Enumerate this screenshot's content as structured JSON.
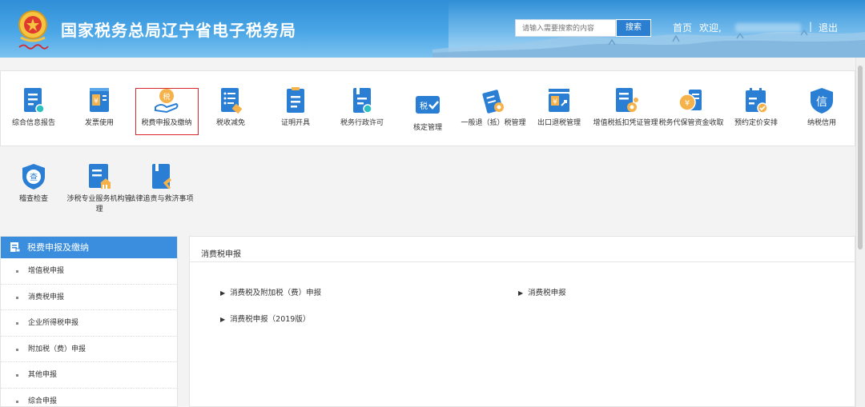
{
  "header": {
    "site_title": "国家税务总局辽宁省电子税务局",
    "search_placeholder": "请输入需要搜索的内容",
    "search_button": "搜索",
    "nav_home": "首页",
    "nav_welcome": "欢迎,",
    "nav_separator": "|",
    "nav_logout": "退出"
  },
  "menu": {
    "items": [
      {
        "label": "综合信息报告",
        "icon": "info-report-icon"
      },
      {
        "label": "发票使用",
        "icon": "invoice-icon"
      },
      {
        "label": "税费申报及缴纳",
        "icon": "tax-payment-icon"
      },
      {
        "label": "税收减免",
        "icon": "tax-relief-icon"
      },
      {
        "label": "证明开具",
        "icon": "certificate-icon"
      },
      {
        "label": "税务行政许可",
        "icon": "license-icon"
      },
      {
        "label": "核定管理",
        "icon": "assessment-icon"
      },
      {
        "label": "一般退（抵）税管理",
        "icon": "refund-icon"
      },
      {
        "label": "出口退税管理",
        "icon": "export-refund-icon"
      },
      {
        "label": "增值税抵扣凭证管理",
        "icon": "vat-voucher-icon"
      },
      {
        "label": "税务代保管资金收取",
        "icon": "custody-fund-icon"
      },
      {
        "label": "预约定价安排",
        "icon": "pricing-icon"
      },
      {
        "label": "纳税信用",
        "icon": "credit-icon"
      },
      {
        "label": "稽查检查",
        "icon": "inspection-icon"
      },
      {
        "label": "涉税专业服务机构管理",
        "icon": "agency-icon"
      },
      {
        "label": "法律追责与救济事项",
        "icon": "legal-icon"
      }
    ],
    "highlight_color": "#d9262b"
  },
  "sidebar": {
    "title": "税费申报及缴纳",
    "items": [
      {
        "label": "增值税申报"
      },
      {
        "label": "消费税申报"
      },
      {
        "label": "企业所得税申报"
      },
      {
        "label": "附加税（费）申报"
      },
      {
        "label": "其他申报"
      },
      {
        "label": "综合申报"
      }
    ]
  },
  "content": {
    "title": "消费税申报",
    "links": [
      {
        "label": "消费税及附加税（费）申报"
      },
      {
        "label": "消费税申报"
      },
      {
        "label": "消费税申报（2019版）"
      }
    ]
  },
  "colors": {
    "brand_blue": "#3b8ede",
    "icon_blue": "#2a7fd4",
    "header_blue": "#2f8ed6"
  }
}
